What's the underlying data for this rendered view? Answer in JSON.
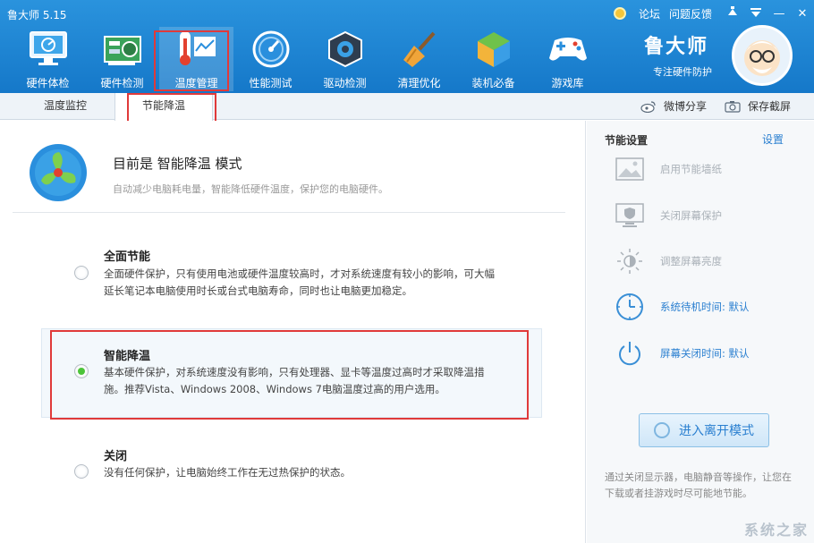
{
  "app": {
    "title": "鲁大师 5.15"
  },
  "topbar": {
    "forum": "论坛",
    "feedback": "问题反馈",
    "skin_icon": "skin-icon",
    "menu_icon": "menu-icon",
    "minimize": "—",
    "close": "✕"
  },
  "nav": [
    {
      "label": "硬件体检",
      "icon": "monitor-icon"
    },
    {
      "label": "硬件检测",
      "icon": "circuit-board-icon"
    },
    {
      "label": "温度管理",
      "icon": "thermometer-icon",
      "active": true
    },
    {
      "label": "性能测试",
      "icon": "speedometer-icon"
    },
    {
      "label": "驱动检测",
      "icon": "gear-box-icon"
    },
    {
      "label": "清理优化",
      "icon": "broom-icon"
    },
    {
      "label": "装机必备",
      "icon": "cube-icon"
    },
    {
      "label": "游戏库",
      "icon": "gamepad-icon"
    }
  ],
  "brand": {
    "name": "鲁大师",
    "tagline": "专注硬件防护"
  },
  "tabs": [
    {
      "label": "温度监控"
    },
    {
      "label": "节能降温",
      "active": true
    }
  ],
  "share": {
    "weibo": "微博分享",
    "screenshot": "保存截屏"
  },
  "main": {
    "mode_title": "目前是 智能降温 模式",
    "mode_desc": "自动减少电脑耗电量，智能降低硬件温度，保护您的电脑硬件。",
    "options": [
      {
        "title": "全面节能",
        "desc1": "全面硬件保护，只有使用电池或硬件温度较高时，才对系统速度有较小的影响，可大幅",
        "desc2": "延长笔记本电脑使用时长或台式电脑寿命，同时也让电脑更加稳定。",
        "checked": false
      },
      {
        "title": "智能降温",
        "desc1": "基本硬件保护，对系统速度没有影响，只有处理器、显卡等温度过高时才采取降温措",
        "desc2": "施。推荐Vista、Windows 2008、Windows 7电脑温度过高的用户选用。",
        "checked": true
      },
      {
        "title": "关闭",
        "desc1": "没有任何保护，让电脑始终工作在无过热保护的状态。",
        "desc2": "",
        "checked": false
      }
    ]
  },
  "side": {
    "title": "节能设置",
    "settings_link": "设置",
    "items": [
      {
        "label": "启用节能墙纸",
        "icon": "wallpaper-icon",
        "active": false
      },
      {
        "label": "关闭屏幕保护",
        "icon": "screen-shield-icon",
        "active": false
      },
      {
        "label": "调整屏幕亮度",
        "icon": "brightness-icon",
        "active": false
      },
      {
        "label": "系统待机时间: 默认",
        "icon": "clock-icon",
        "active": true
      },
      {
        "label": "屏幕关闭时间: 默认",
        "icon": "power-icon",
        "active": true
      }
    ],
    "leave_button": "进入离开模式",
    "note": "通过关闭显示器，电脑静音等操作，让您在下载或者挂游戏时尽可能地节能。"
  },
  "watermark": "系统之家"
}
